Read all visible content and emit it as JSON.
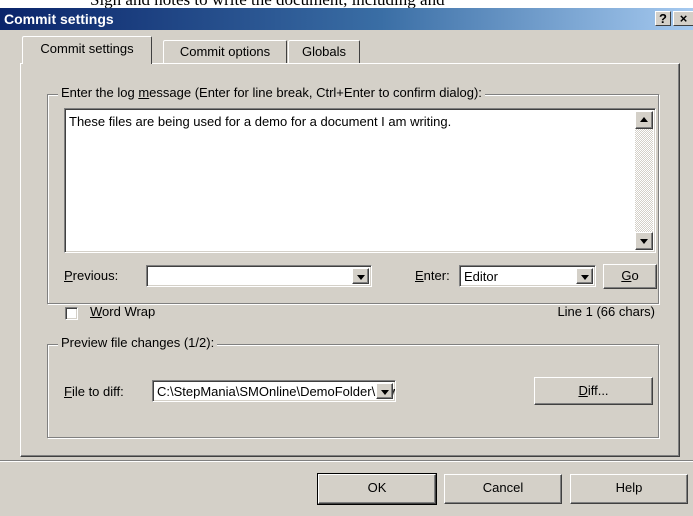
{
  "page": {
    "top_text": "Sign and notes to write the document, including and"
  },
  "window": {
    "title": "Commit settings",
    "help_btn": "?",
    "close_btn": "×"
  },
  "tabs": [
    {
      "label": "Commit settings",
      "active": true
    },
    {
      "label": "Commit options",
      "active": false
    },
    {
      "label": "Globals",
      "active": false
    }
  ],
  "log_group": {
    "label_pre": "Enter the log ",
    "label_accel": "m",
    "label_post": "essage (Enter for line break, Ctrl+Enter to confirm dialog):",
    "message": "These files are being used for a demo for a document I am writing."
  },
  "previous": {
    "label_accel": "P",
    "label_rest": "revious:",
    "value": ""
  },
  "enter": {
    "label_accel": "E",
    "label_rest": "nter:",
    "value": "Editor",
    "go_accel": "G",
    "go_rest": "o"
  },
  "word_wrap": {
    "label_accel": "W",
    "label_rest": "ord Wrap",
    "checked": false
  },
  "line_info": "Line 1 (66 chars)",
  "preview_group": {
    "label": "Preview file changes (1/2):",
    "file_label_accel": "F",
    "file_label_rest": "ile to diff:",
    "file_value": "C:\\StepMania\\SMOnline\\DemoFolder\\newFil",
    "diff_accel": "D",
    "diff_rest": "iff..."
  },
  "buttons": {
    "ok": "OK",
    "cancel": "Cancel",
    "help": "Help"
  },
  "colors": {
    "face": "#d4d0c8",
    "title_start": "#0a246a",
    "title_end": "#a6caf0"
  }
}
